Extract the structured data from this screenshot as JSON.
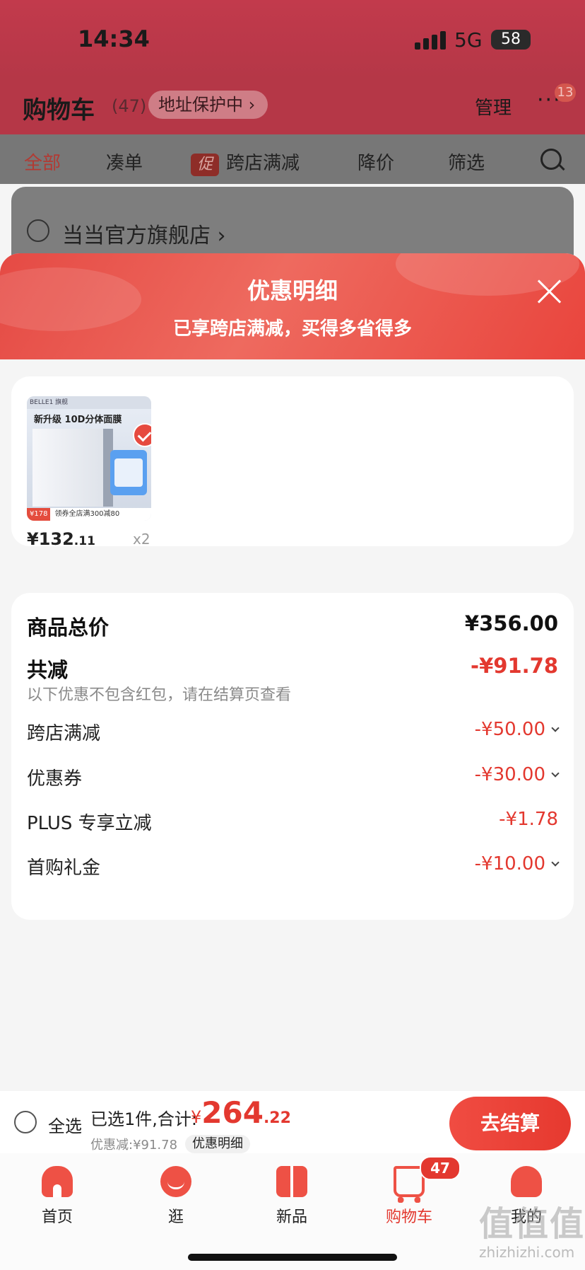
{
  "status": {
    "time": "14:34",
    "network": "5G",
    "battery": "58"
  },
  "header": {
    "title": "购物车",
    "count": "(47)",
    "address_protect": "地址保护中 ›",
    "manage": "管理",
    "more": "···",
    "msg_badge": "13"
  },
  "filters": {
    "all": "全部",
    "combine": "凑单",
    "promo_tag": "促",
    "cross_store": "跨店满减",
    "price_drop": "降价",
    "filter": "筛选"
  },
  "store": {
    "name": "当当官方旗舰店 ›"
  },
  "sheet": {
    "title": "优惠明细",
    "subtitle": "已享跨店满减，买得多省得多"
  },
  "product": {
    "thumb_brand": "BELLE1 旗舰",
    "thumb_headline": "新升级 10D分体面膜",
    "thumb_price_tag": "¥178",
    "thumb_coupon": "领券全店满300减80",
    "price_int": "¥132",
    "price_dec": ".11",
    "qty": "x2"
  },
  "summary": {
    "total_label": "商品总价",
    "total_value": "¥356.00",
    "reduce_label": "共减",
    "reduce_value": "-¥91.78",
    "reduce_note": "以下优惠不包含红包，请在结算页查看",
    "items": [
      {
        "label": "跨店满减",
        "value": "-¥50.00"
      },
      {
        "label": "优惠券",
        "value": "-¥30.00"
      },
      {
        "label": "PLUS 专享立减",
        "value": "-¥1.78"
      },
      {
        "label": "首购礼金",
        "value": "-¥10.00"
      }
    ]
  },
  "checkout": {
    "select_all": "全选",
    "selected_info": "已选1件,合计:",
    "currency": "¥",
    "total_int": "264",
    "total_dec": ".22",
    "discount": "优惠减:¥91.78",
    "detail": "优惠明细",
    "pay": "去结算"
  },
  "tabs": [
    {
      "label": "首页",
      "icon": "home-icon"
    },
    {
      "label": "逛",
      "icon": "explore-icon"
    },
    {
      "label": "新品",
      "icon": "new-product-icon"
    },
    {
      "label": "购物车",
      "icon": "cart-icon",
      "badge": "47"
    },
    {
      "label": "我的",
      "icon": "profile-icon"
    }
  ],
  "watermark": {
    "logo": "值值值",
    "site": "zhizhizhi.com"
  },
  "colors": {
    "accent": "#e3382f",
    "header_bg": "#b53747"
  }
}
